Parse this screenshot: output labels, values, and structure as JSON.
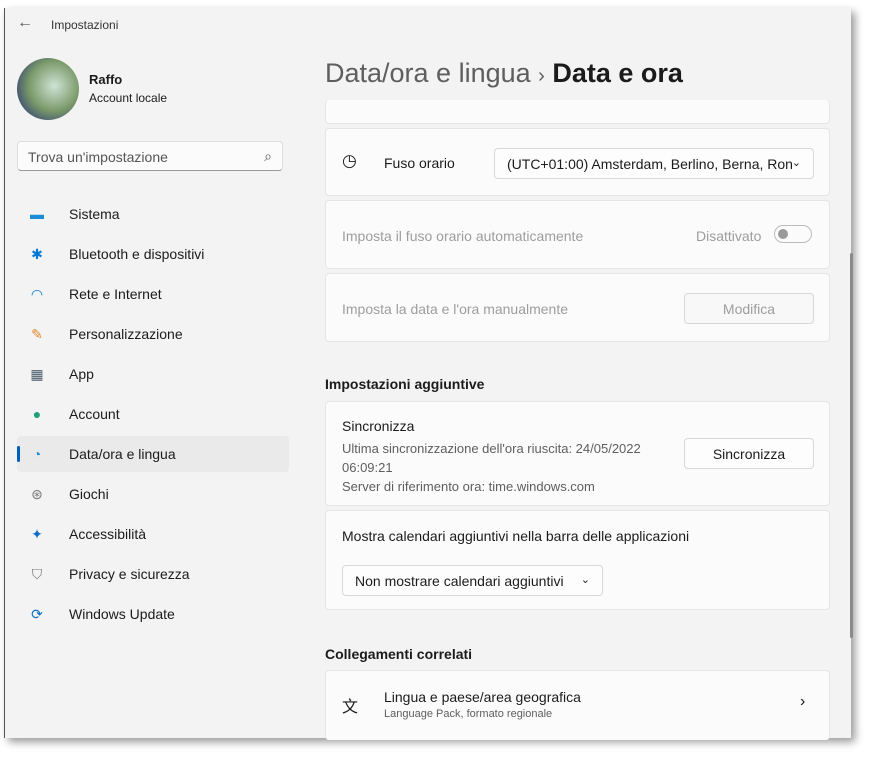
{
  "window": {
    "title": "Impostazioni"
  },
  "user": {
    "name": "Raffo",
    "type": "Account locale"
  },
  "search": {
    "placeholder": "Trova un'impostazione"
  },
  "sidebar": {
    "items": [
      {
        "label": "Sistema",
        "icon": "monitor-icon",
        "glyph": "▬",
        "color": "#1a8cd8"
      },
      {
        "label": "Bluetooth e dispositivi",
        "icon": "bluetooth-icon",
        "glyph": "✱",
        "color": "#0078d4"
      },
      {
        "label": "Rete e Internet",
        "icon": "wifi-icon",
        "glyph": "◠",
        "color": "#0078d4"
      },
      {
        "label": "Personalizzazione",
        "icon": "brush-icon",
        "glyph": "✎",
        "color": "#e08a2a"
      },
      {
        "label": "App",
        "icon": "apps-icon",
        "glyph": "▦",
        "color": "#4a5a6a"
      },
      {
        "label": "Account",
        "icon": "person-icon",
        "glyph": "●",
        "color": "#1fa07a"
      },
      {
        "label": "Data/ora e lingua",
        "icon": "clock-globe-icon",
        "glyph": "◔",
        "color": "#1a8cd8",
        "selected": true
      },
      {
        "label": "Giochi",
        "icon": "gamepad-icon",
        "glyph": "⊛",
        "color": "#777"
      },
      {
        "label": "Accessibilità",
        "icon": "accessibility-icon",
        "glyph": "✦",
        "color": "#0a6cc8"
      },
      {
        "label": "Privacy e sicurezza",
        "icon": "shield-icon",
        "glyph": "⛉",
        "color": "#777"
      },
      {
        "label": "Windows Update",
        "icon": "update-icon",
        "glyph": "⟳",
        "color": "#0a6cc8"
      }
    ]
  },
  "breadcrumb": {
    "parent": "Data/ora e lingua",
    "sep": "›",
    "current": "Data e ora"
  },
  "timezone": {
    "label": "Fuso orario",
    "value": "(UTC+01:00) Amsterdam, Berlino, Berna, Ron"
  },
  "auto_tz": {
    "label": "Imposta il fuso orario automaticamente",
    "state": "Disattivato",
    "on": false
  },
  "manual": {
    "label": "Imposta la data e l'ora manualmente",
    "button": "Modifica"
  },
  "additional": {
    "heading": "Impostazioni aggiuntive",
    "sync": {
      "title": "Sincronizza",
      "last": "Ultima sincronizzazione dell'ora riuscita: 24/05/2022",
      "time": "06:09:21",
      "server": "Server di riferimento ora: time.windows.com",
      "button": "Sincronizza"
    },
    "calendars": {
      "label": "Mostra calendari aggiuntivi nella barra delle applicazioni",
      "value": "Non mostrare calendari aggiuntivi"
    }
  },
  "related": {
    "heading": "Collegamenti correlati",
    "link": {
      "title": "Lingua e paese/area geografica",
      "subtitle": "Language Pack, formato regionale"
    }
  }
}
